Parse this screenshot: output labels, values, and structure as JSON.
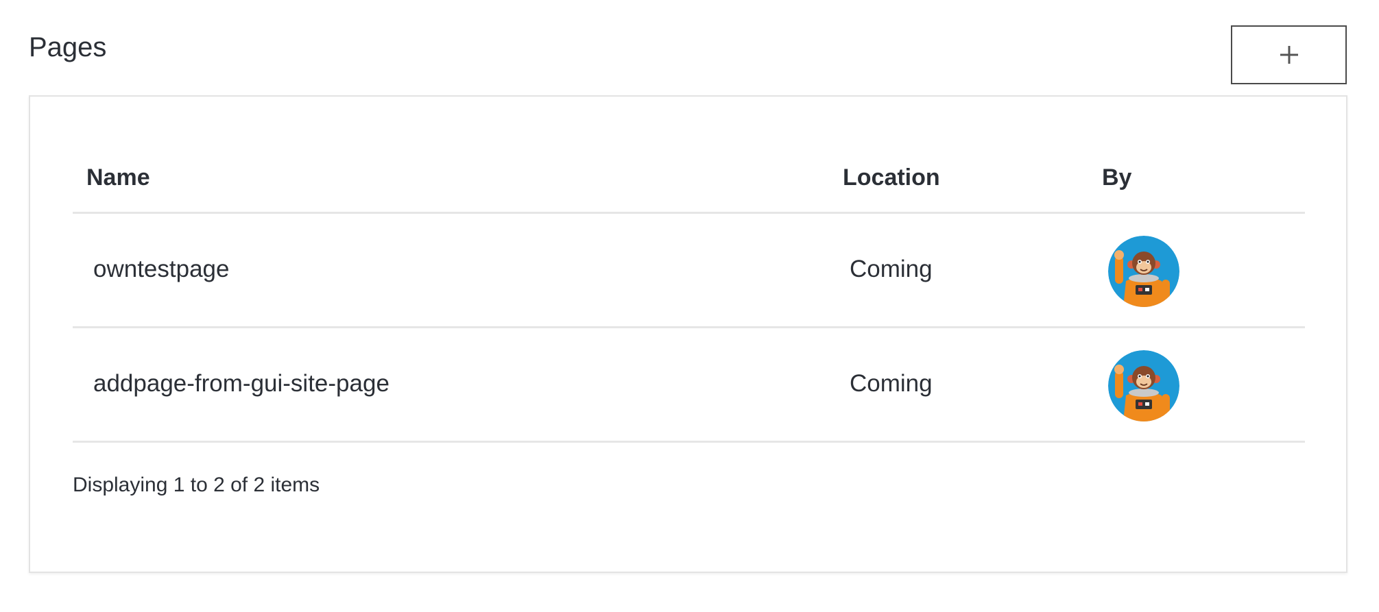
{
  "header": {
    "title": "Pages",
    "add_button_label": "+"
  },
  "table": {
    "columns": {
      "name": "Name",
      "location": "Location",
      "by": "By"
    },
    "rows": [
      {
        "name": "owntestpage",
        "location": "Coming",
        "by_icon": "astronaut-monkey-avatar"
      },
      {
        "name": "addpage-from-gui-site-page",
        "location": "Coming",
        "by_icon": "astronaut-monkey-avatar"
      }
    ]
  },
  "footer": {
    "status": "Displaying 1 to 2 of 2 items"
  },
  "colors": {
    "avatar_background": "#1e9ad6",
    "suit": "#f08a1c",
    "border": "#e3e3e3"
  }
}
